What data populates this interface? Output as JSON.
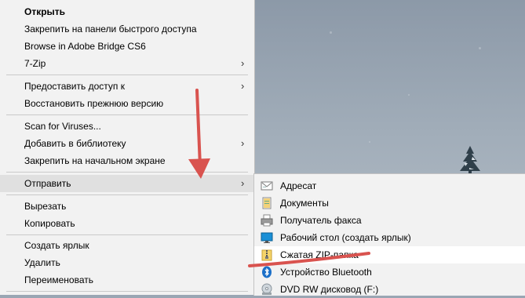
{
  "context_menu": {
    "items": [
      {
        "label": "Открыть",
        "bold": true
      },
      {
        "label": "Закрепить на панели быстрого доступа"
      },
      {
        "label": "Browse in Adobe Bridge CS6"
      },
      {
        "label": "7-Zip",
        "has_submenu": true
      },
      {
        "label": "Предоставить доступ к",
        "has_submenu": true
      },
      {
        "label": "Восстановить прежнюю версию"
      },
      {
        "label": "Scan for Viruses..."
      },
      {
        "label": "Добавить в библиотеку",
        "has_submenu": true
      },
      {
        "label": "Закрепить на начальном экране"
      },
      {
        "label": "Отправить",
        "has_submenu": true,
        "highlighted": true
      },
      {
        "label": "Вырезать"
      },
      {
        "label": "Копировать"
      },
      {
        "label": "Создать ярлык"
      },
      {
        "label": "Удалить"
      },
      {
        "label": "Переименовать"
      }
    ]
  },
  "send_to_submenu": {
    "items": [
      {
        "label": "Адресат",
        "icon": "mail-recipient-icon"
      },
      {
        "label": "Документы",
        "icon": "documents-folder-icon"
      },
      {
        "label": "Получатель факса",
        "icon": "fax-icon"
      },
      {
        "label": "Рабочий стол (создать ярлык)",
        "icon": "desktop-icon"
      },
      {
        "label": "Сжатая ZIP-папка",
        "icon": "zip-folder-icon",
        "highlighted": true
      },
      {
        "label": "Устройство Bluetooth",
        "icon": "bluetooth-icon"
      },
      {
        "label": "DVD RW дисковод (F:)",
        "icon": "dvd-drive-icon"
      }
    ]
  },
  "colors": {
    "menu_bg": "#f2f2f2",
    "annotation_red": "#d9534f"
  }
}
